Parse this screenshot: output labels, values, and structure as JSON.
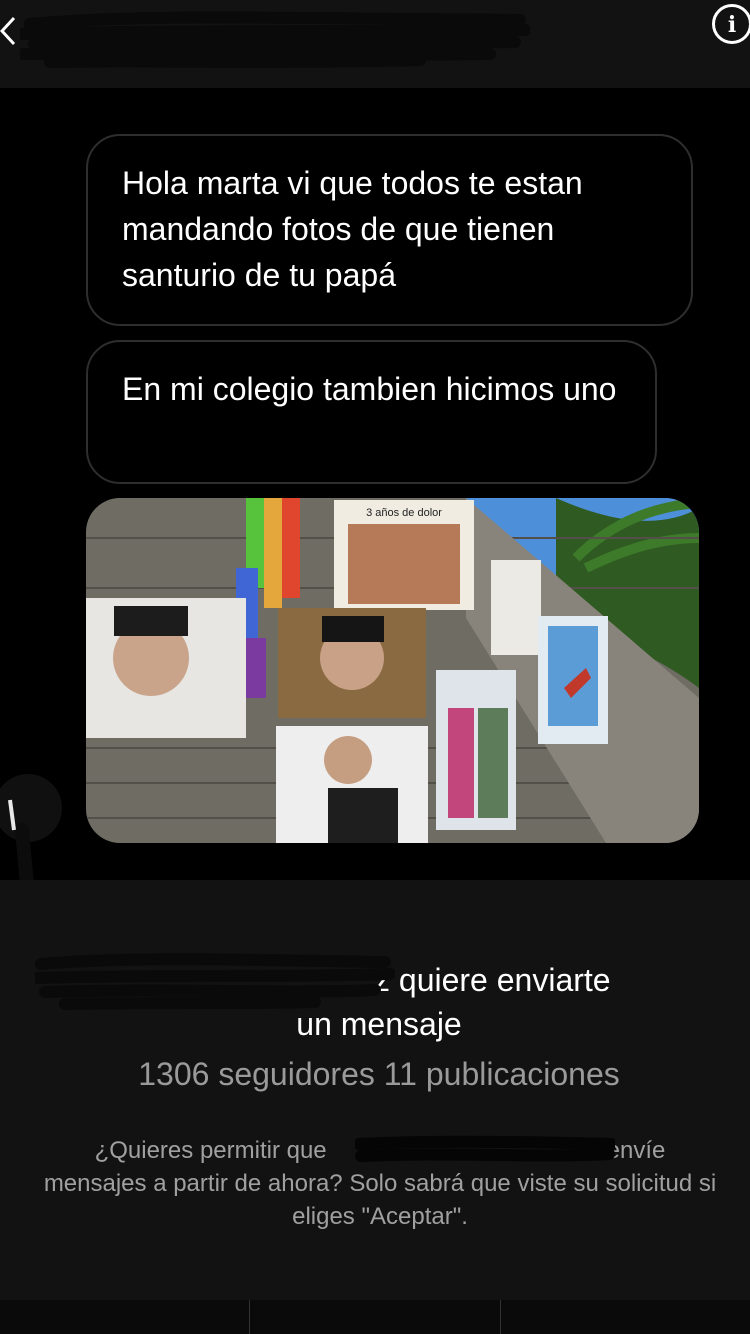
{
  "header": {
    "back_icon": "chevron-left-icon",
    "info_icon": "info-icon",
    "info_glyph": "i"
  },
  "messages": [
    {
      "text": "Hola marta vi que todos te estan mandando fotos de que tienen santurio de tu papá"
    },
    {
      "text": "En mi colegio tambien hicimos uno"
    }
  ],
  "photo": {
    "sign_text": "3 años de dolor"
  },
  "request": {
    "title_line1": "z quiere enviarte",
    "title_line2": "un mensaje",
    "followers": "1306 seguidores",
    "posts": "11 publicaciones",
    "note_part1": "¿Quieres permitir que",
    "note_part2": "te envíe",
    "note_part3": "mensajes a partir de ahora? Solo sabrá que viste su solicitud si eliges \"Aceptar\"."
  },
  "actions": {
    "delete": "",
    "block": "",
    "accept": ""
  }
}
